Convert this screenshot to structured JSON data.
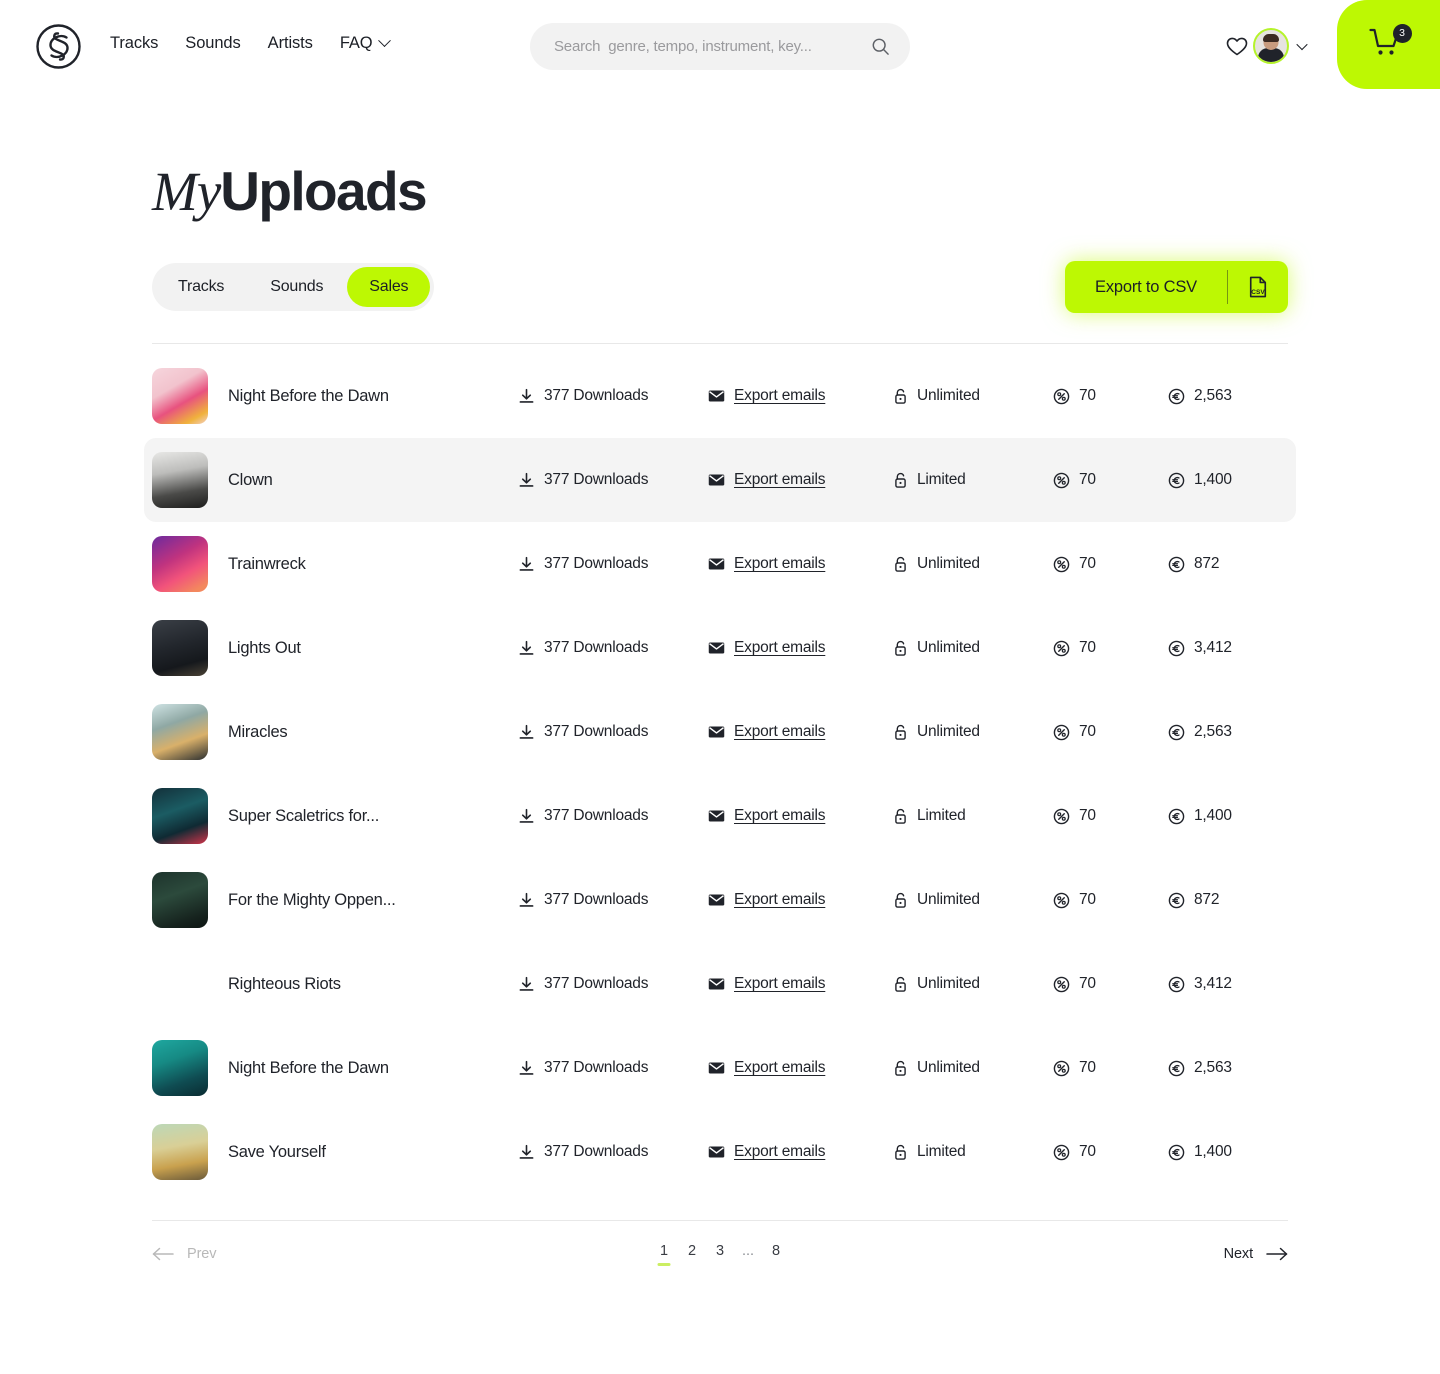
{
  "brand": {
    "logo_icon": "sonic-loop-logo-icon",
    "accent": "#BDF803",
    "dark": "#20232A"
  },
  "header": {
    "nav": [
      {
        "label": "Tracks",
        "has_chevron": false
      },
      {
        "label": "Sounds",
        "has_chevron": false
      },
      {
        "label": "Artists",
        "has_chevron": false
      },
      {
        "label": "FAQ",
        "has_chevron": true
      }
    ],
    "search": {
      "placeholder": "Search  genre, tempo, instrument, key...",
      "value": "",
      "icon": "search-icon"
    },
    "favorites_icon": "heart-icon",
    "account_chevron_icon": "chevron-down-icon",
    "cart": {
      "icon": "shopping-cart-icon",
      "count": "3"
    }
  },
  "page": {
    "title_italic": "My",
    "title_bold": "Uploads",
    "tabs": [
      {
        "label": "Tracks",
        "active": false
      },
      {
        "label": "Sounds",
        "active": false
      },
      {
        "label": "Sales",
        "active": true
      }
    ],
    "export_button": {
      "label": "Export to CSV",
      "icon": "csv-file-icon"
    }
  },
  "table": {
    "icons": {
      "downloads": "download-icon",
      "emails": "envelope-icon",
      "license": "open-lock-icon",
      "royalty": "percent-circle-icon",
      "revenue": "euro-circle-icon"
    },
    "rows": [
      {
        "name": "Night Before the Dawn",
        "downloads": "377 Downloads",
        "emails": "Export emails",
        "license": "Unlimited",
        "royalty": "70",
        "revenue": "2,563",
        "highlight": false,
        "art": "pink-fashion-collage"
      },
      {
        "name": "Clown",
        "downloads": "377 Downloads",
        "emails": "Export emails",
        "license": "Limited",
        "royalty": "70",
        "revenue": "1,400",
        "highlight": true,
        "art": "bw-street-dancers"
      },
      {
        "name": "Trainwreck",
        "downloads": "377 Downloads",
        "emails": "Export emails",
        "license": "Unlimited",
        "royalty": "70",
        "revenue": "872",
        "highlight": false,
        "art": "magenta-purple-figure"
      },
      {
        "name": "Lights Out",
        "downloads": "377 Downloads",
        "emails": "Export emails",
        "license": "Unlimited",
        "royalty": "70",
        "revenue": "3,412",
        "highlight": false,
        "art": "dark-night-skater"
      },
      {
        "name": "Miracles",
        "downloads": "377 Downloads",
        "emails": "Export emails",
        "license": "Unlimited",
        "royalty": "70",
        "revenue": "2,563",
        "highlight": false,
        "art": "teal-white-motion"
      },
      {
        "name": "Super Scaletrics for...",
        "downloads": "377 Downloads",
        "emails": "Export emails",
        "license": "Limited",
        "royalty": "70",
        "revenue": "1,400",
        "highlight": false,
        "art": "neon-car-night"
      },
      {
        "name": "For the Mighty Oppen...",
        "downloads": "377 Downloads",
        "emails": "Export emails",
        "license": "Unlimited",
        "royalty": "70",
        "revenue": "872",
        "highlight": false,
        "art": "dark-green-portrait"
      },
      {
        "name": "Righteous Riots",
        "downloads": "377 Downloads",
        "emails": "Export emails",
        "license": "Unlimited",
        "royalty": "70",
        "revenue": "3,412",
        "highlight": false,
        "art": "grey-walking-figure"
      },
      {
        "name": "Night Before the Dawn",
        "downloads": "377 Downloads",
        "emails": "Export emails",
        "license": "Unlimited",
        "royalty": "70",
        "revenue": "2,563",
        "highlight": false,
        "art": "teal-city-portrait"
      },
      {
        "name": "Save Yourself",
        "downloads": "377 Downloads",
        "emails": "Export emails",
        "license": "Limited",
        "royalty": "70",
        "revenue": "1,400",
        "highlight": false,
        "art": "warm-skyline-figure"
      }
    ]
  },
  "pagination": {
    "prev_label": "Prev",
    "next_label": "Next",
    "prev_icon": "arrow-left-icon",
    "next_icon": "arrow-right-icon",
    "pages": [
      "1",
      "2",
      "3",
      "...",
      "8"
    ],
    "current": "1"
  }
}
